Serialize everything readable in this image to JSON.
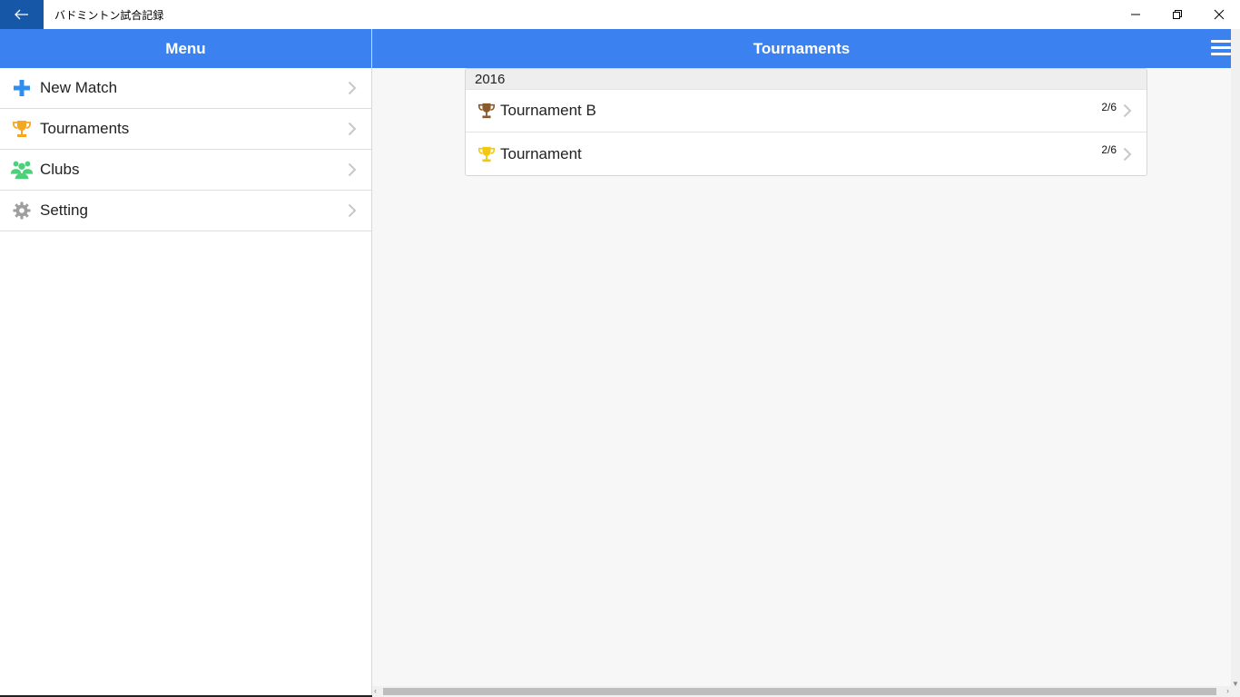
{
  "window": {
    "title": "バドミントン試合記録",
    "back_icon": "arrow-left-icon",
    "controls": [
      "minimize-icon",
      "restore-icon",
      "close-icon"
    ]
  },
  "sidebar": {
    "header": "Menu",
    "items": [
      {
        "label": "New Match",
        "icon": "plus-icon",
        "icon_color": "#2f8ef0"
      },
      {
        "label": "Tournaments",
        "icon": "trophy-icon",
        "icon_color": "#f5a623"
      },
      {
        "label": "Clubs",
        "icon": "group-icon",
        "icon_color": "#4cd07a"
      },
      {
        "label": "Setting",
        "icon": "gear-icon",
        "icon_color": "#9e9e9e"
      }
    ]
  },
  "main": {
    "header": "Tournaments",
    "menu_icon": "hamburger-icon",
    "groups": [
      {
        "label": "2016",
        "rows": [
          {
            "label": "Tournament B",
            "count": "2/6",
            "icon": "trophy-icon",
            "icon_color": "#8b5a2b"
          },
          {
            "label": "Tournament",
            "count": "2/6",
            "icon": "trophy-icon",
            "icon_color": "#f2c811"
          }
        ]
      }
    ]
  },
  "colors": {
    "header_blue": "#3b82f0",
    "back_button": "#1757a8"
  }
}
